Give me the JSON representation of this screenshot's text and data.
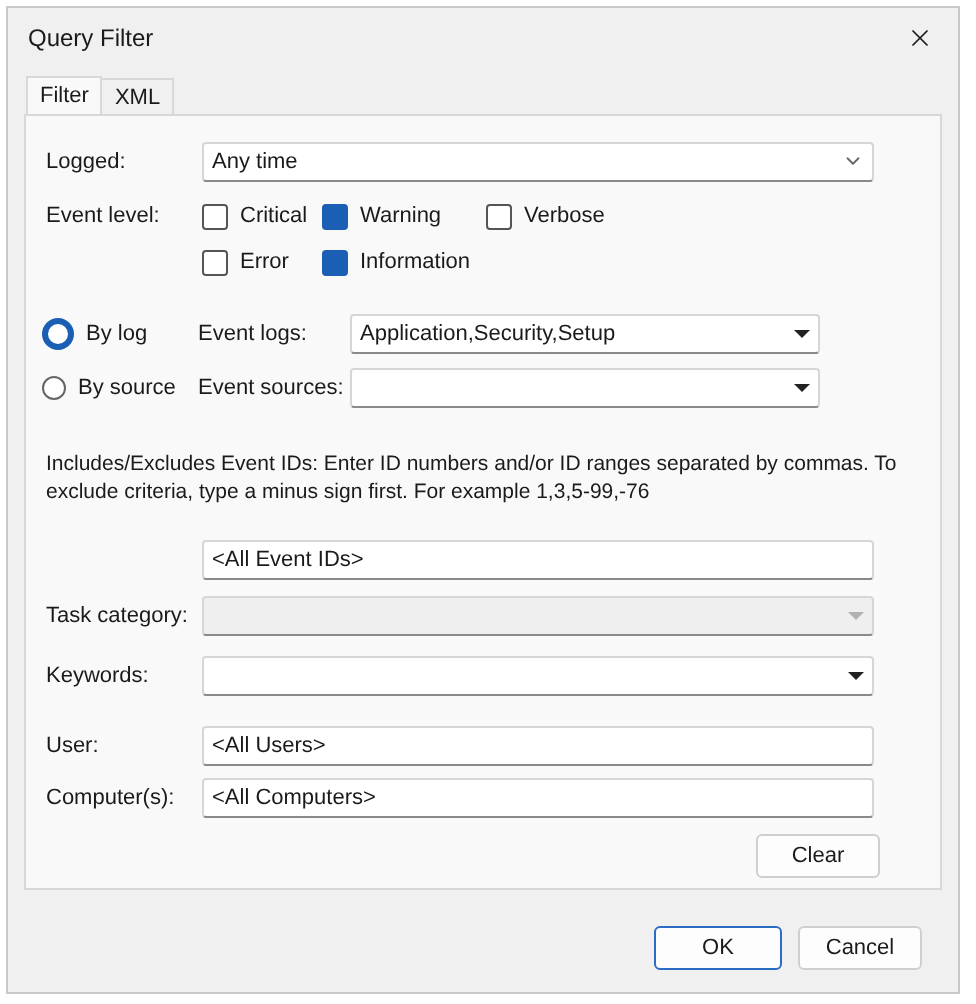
{
  "window": {
    "title": "Query Filter"
  },
  "tabs": [
    {
      "label": "Filter",
      "selected": true
    },
    {
      "label": "XML",
      "selected": false
    }
  ],
  "logged": {
    "label": "Logged:",
    "value": "Any time"
  },
  "event_level": {
    "label": "Event level:",
    "options": [
      {
        "label": "Critical",
        "checked": false
      },
      {
        "label": "Warning",
        "checked": true
      },
      {
        "label": "Verbose",
        "checked": false
      },
      {
        "label": "Error",
        "checked": false
      },
      {
        "label": "Information",
        "checked": true
      }
    ]
  },
  "sources": [
    {
      "label": "By log",
      "selected": true,
      "field_label": "Event logs:",
      "value": "Application,Security,Setup"
    },
    {
      "label": "By source",
      "selected": false,
      "field_label": "Event sources:"
    }
  ],
  "description": "Includes/Excludes Event IDs: Enter ID numbers and/or ID ranges separated by commas. To exclude criteria, type a minus sign first. For example 1,3,5-99,-76",
  "event_ids": {
    "value": "<All Event IDs>"
  },
  "task_category": {
    "label": "Task category:",
    "disabled": true
  },
  "keywords": {
    "label": "Keywords:",
    "disabled": false
  },
  "user": {
    "label": "User:",
    "value": "<All Users>"
  },
  "computers": {
    "label": "Computer(s):",
    "value": "<All Computers>"
  },
  "clear_button": "Clear",
  "buttons": [
    {
      "label": "OK",
      "default": true
    },
    {
      "label": "Cancel",
      "default": false
    }
  ]
}
